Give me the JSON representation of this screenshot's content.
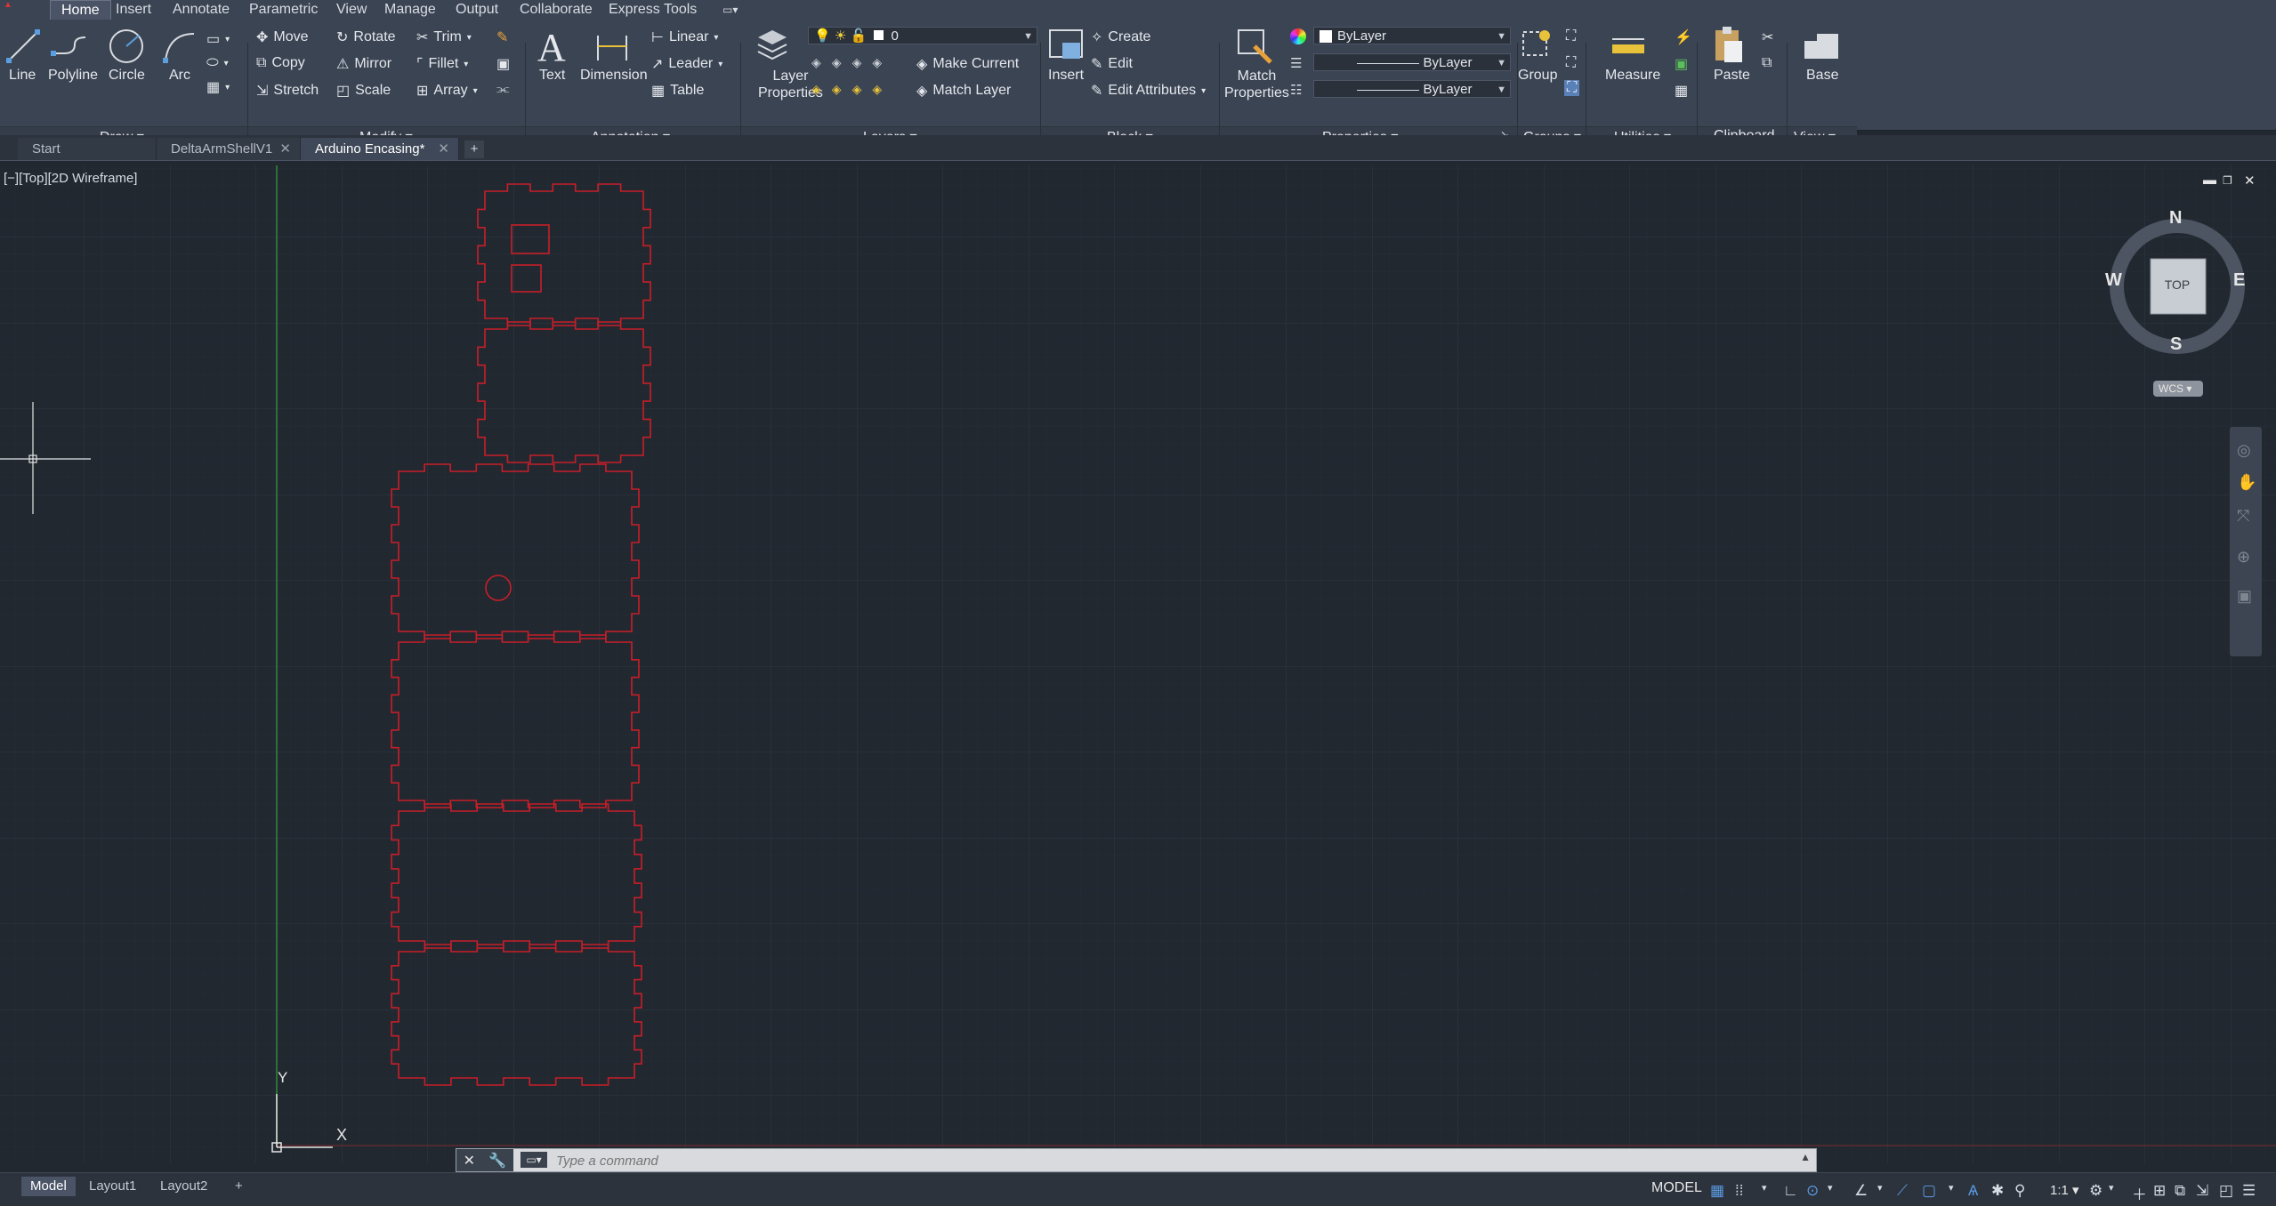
{
  "menu_tabs": [
    "Home",
    "Insert",
    "Annotate",
    "Parametric",
    "View",
    "Manage",
    "Output",
    "Collaborate",
    "Express Tools"
  ],
  "draw": {
    "line": "Line",
    "polyline": "Polyline",
    "circle": "Circle",
    "arc": "Arc",
    "panel": "Draw"
  },
  "modify": {
    "move": "Move",
    "rotate": "Rotate",
    "trim": "Trim",
    "copy": "Copy",
    "mirror": "Mirror",
    "fillet": "Fillet",
    "stretch": "Stretch",
    "scale": "Scale",
    "array": "Array",
    "panel": "Modify"
  },
  "annotation": {
    "text": "Text",
    "dimension": "Dimension",
    "linear": "Linear",
    "leader": "Leader",
    "table": "Table",
    "panel": "Annotation"
  },
  "layers": {
    "layer_properties_1": "Layer",
    "layer_properties_2": "Properties",
    "current_layer": "0",
    "make_current": "Make Current",
    "match_layer": "Match Layer",
    "panel": "Layers"
  },
  "block": {
    "insert": "Insert",
    "create": "Create",
    "edit": "Edit",
    "edit_attributes": "Edit Attributes",
    "panel": "Block"
  },
  "properties": {
    "match_1": "Match",
    "match_2": "Properties",
    "color": "ByLayer",
    "linetype": "ByLayer",
    "lineweight": "ByLayer",
    "panel": "Properties"
  },
  "groups": {
    "group": "Group",
    "panel": "Groups"
  },
  "utilities": {
    "measure": "Measure",
    "panel": "Utilities"
  },
  "clipboard": {
    "paste": "Paste",
    "panel": "Clipboard"
  },
  "view_panel": {
    "base": "Base",
    "panel": "View"
  },
  "file_tabs": [
    "Start",
    "DeltaArmShellV1",
    "Arduino Encasing*"
  ],
  "viewport_label": "[−][Top][2D Wireframe]",
  "viewcube": {
    "n": "N",
    "s": "S",
    "e": "E",
    "w": "W",
    "top": "TOP",
    "wcs": "WCS"
  },
  "ucs": {
    "x": "X",
    "y": "Y"
  },
  "command": {
    "placeholder": "Type a command"
  },
  "layout_tabs": [
    "Model",
    "Layout1",
    "Layout2"
  ],
  "status": {
    "model": "MODEL",
    "scale": "1:1"
  },
  "colors": {
    "ribbon": "#3b4453",
    "canvas": "#212830",
    "geometry": "#c81e28",
    "y_axis": "#2f8a3a",
    "grid_major": "#2e3744",
    "grid_minor": "#262d37"
  }
}
